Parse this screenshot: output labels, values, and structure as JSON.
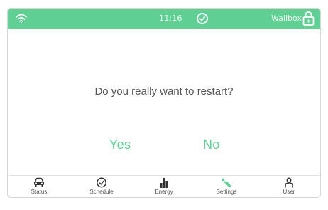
{
  "status_bar": {
    "time": "11:16",
    "device_name": "Wallbox",
    "icons": [
      "wifi-icon",
      "clock-icon",
      "lock-icon"
    ]
  },
  "dialog": {
    "question": "Do you really want to restart?",
    "yes_label": "Yes",
    "no_label": "No"
  },
  "nav": {
    "items": [
      {
        "label": "Status",
        "icon": "car-icon"
      },
      {
        "label": "Schedule",
        "icon": "clock-icon"
      },
      {
        "label": "Energy",
        "icon": "bar-chart-icon"
      },
      {
        "label": "Settings",
        "icon": "wrench-icon"
      },
      {
        "label": "User",
        "icon": "user-icon"
      }
    ]
  },
  "colors": {
    "accent": "#5fcf94",
    "text": "#555555",
    "icon_dark": "#333333"
  }
}
